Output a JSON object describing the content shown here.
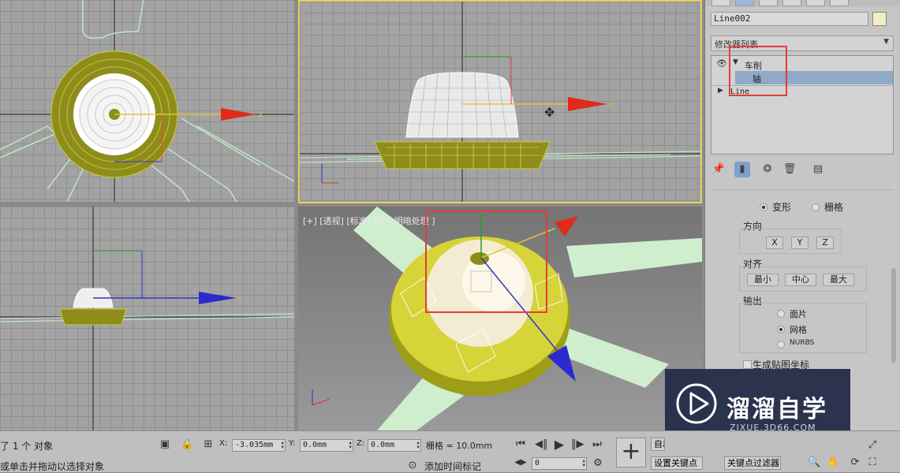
{
  "viewports": {
    "front_axis": "x",
    "left_axis": "z",
    "persp_label": "[+] [透视] [标准] [默认明暗处理 ]"
  },
  "panel": {
    "object_name": "Line002",
    "object_color": "#f3edc4",
    "modifier_list": "修改器列表",
    "stack": [
      {
        "label": "车削",
        "expanded": true
      },
      {
        "label": "轴",
        "selected": true
      },
      {
        "label": "Line"
      }
    ],
    "params": {
      "deform_label": "变形",
      "grid_label": "栅格",
      "direction_title": "方向",
      "dir_x": "X",
      "dir_y": "Y",
      "dir_z": "Z",
      "align_title": "对齐",
      "align_min": "最小",
      "align_center": "中心",
      "align_max": "最大",
      "output_title": "输出",
      "out_patch": "面片",
      "out_mesh": "网格",
      "out_nurbs": "NURBS",
      "gen_map_coords": "生成贴图坐标"
    }
  },
  "status": {
    "selected_text": "了 1 个 对象",
    "hint_text": "或单击并拖动以选择对象",
    "x_label": "X:",
    "x_value": "-3.035mm",
    "y_label": "Y:",
    "y_value": "0.0mm",
    "z_label": "Z:",
    "z_value": "0.0mm",
    "grid_text": "栅格 = 10.0mm",
    "add_time_tag": "添加时间标记",
    "frame_value": "0",
    "auto_key": "自动",
    "set_key": "设置关键点",
    "key_filters": "关键点过滤器..."
  },
  "watermark": {
    "title": "溜溜自学",
    "subtitle": "ZIXUE.3D66.COM"
  },
  "colors": {
    "accent_red": "#e43c3c",
    "active_viewport": "#e6d25a",
    "selection_blue": "#8fa9c9",
    "model_olive": "#9a9a1e"
  }
}
